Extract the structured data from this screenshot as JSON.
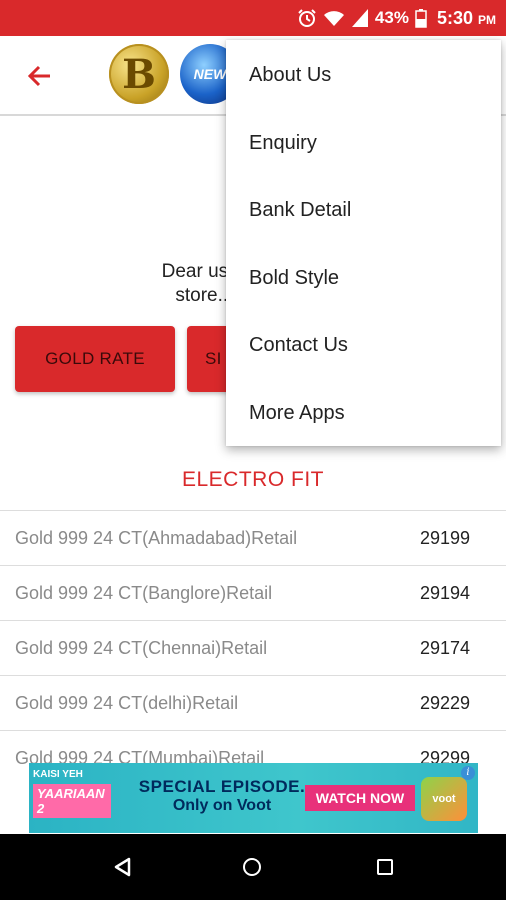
{
  "status_bar": {
    "battery_percent": "43%",
    "time": "5:30",
    "ampm": "PM",
    "icons": [
      "alarm-icon",
      "wifi-icon",
      "signal-icon",
      "battery-icon"
    ]
  },
  "app_bar": {
    "back_icon": "arrow-left-icon",
    "logo_letter": "B",
    "logo2_text": "NEW"
  },
  "intro": {
    "line1": "Dear user if you are e",
    "line2": "store... more and r"
  },
  "buttons": {
    "gold_rate": "GOLD RATE",
    "silver_rate": "SI"
  },
  "section_title": "ELECTRO FIT",
  "rates": [
    {
      "name": "Gold 999 24 CT(Ahmadabad)Retail",
      "value": "29199"
    },
    {
      "name": "Gold 999 24 CT(Banglore)Retail",
      "value": "29194"
    },
    {
      "name": "Gold 999 24 CT(Chennai)Retail",
      "value": "29174"
    },
    {
      "name": "Gold 999 24 CT(delhi)Retail",
      "value": "29229"
    },
    {
      "name": "Gold 999 24 CT(Mumbai)Retail",
      "value": "29299"
    }
  ],
  "ad": {
    "tag1": "KAISI YEH",
    "tag2": "YAARIAAN 2",
    "line1": "SPECIAL EPISODE.",
    "line2": "Only on Voot",
    "cta": "WATCH NOW",
    "brand": "voot",
    "info": "i"
  },
  "menu": {
    "items": [
      "About Us",
      "Enquiry",
      "Bank Detail",
      "Bold Style",
      "Contact Us",
      "More Apps"
    ]
  },
  "colors": {
    "accent": "#d9292b",
    "statusbar": "#d9292b",
    "navbar": "#000000"
  }
}
